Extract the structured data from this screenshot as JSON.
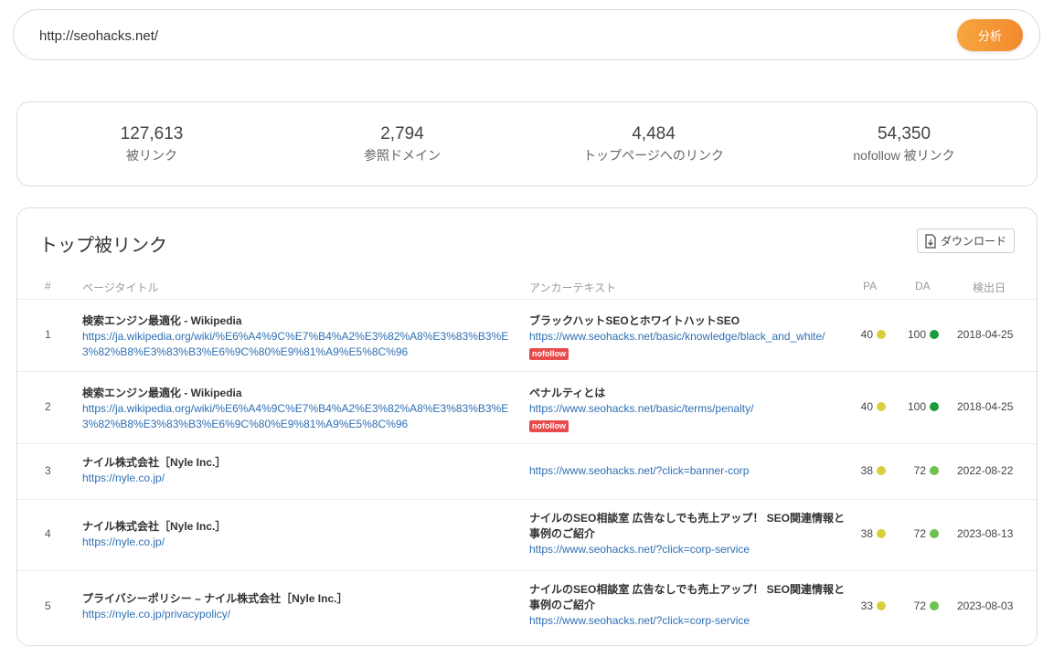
{
  "search": {
    "value": "http://seohacks.net/",
    "button_label": "分析"
  },
  "stats": [
    {
      "value": "127,613",
      "label": "被リンク"
    },
    {
      "value": "2,794",
      "label": "参照ドメイン"
    },
    {
      "value": "4,484",
      "label": "トップページへのリンク"
    },
    {
      "value": "54,350",
      "label": "nofollow 被リンク"
    }
  ],
  "panel": {
    "title": "トップ被リンク",
    "download_label": "ダウンロード",
    "columns": {
      "num": "#",
      "page_title": "ページタイトル",
      "anchor": "アンカーテキスト",
      "pa": "PA",
      "da": "DA",
      "date": "検出日"
    }
  },
  "colors": {
    "accent": "#f28a2e",
    "link": "#2f6fb4",
    "badge": "#e84b4b",
    "dot_yellow": "#d9cf3a",
    "dot_green_dark": "#1a9c3a",
    "dot_green": "#6cc24a"
  },
  "rows": [
    {
      "num": "1",
      "title": "検索エンジン最適化 - Wikipedia",
      "url": "https://ja.wikipedia.org/wiki/%E6%A4%9C%E7%B4%A2%E3%82%A8%E3%83%B3%E3%82%B8%E3%83%B3%E6%9C%80%E9%81%A9%E5%8C%96",
      "anchor": "ブラックハットSEOとホワイトハットSEO",
      "anchor_url": "https://www.seohacks.net/basic/knowledge/black_and_white/",
      "nofollow": "nofollow",
      "pa": "40",
      "da": "100",
      "date": "2018-04-25"
    },
    {
      "num": "2",
      "title": "検索エンジン最適化 - Wikipedia",
      "url": "https://ja.wikipedia.org/wiki/%E6%A4%9C%E7%B4%A2%E3%82%A8%E3%83%B3%E3%82%B8%E3%83%B3%E6%9C%80%E9%81%A9%E5%8C%96",
      "anchor": "ペナルティとは",
      "anchor_url": "https://www.seohacks.net/basic/terms/penalty/",
      "nofollow": "nofollow",
      "pa": "40",
      "da": "100",
      "date": "2018-04-25"
    },
    {
      "num": "3",
      "title": "ナイル株式会社［Nyle Inc.］",
      "url": "https://nyle.co.jp/",
      "anchor": "",
      "anchor_url": "https://www.seohacks.net/?click=banner-corp",
      "nofollow": "",
      "pa": "38",
      "da": "72",
      "date": "2022-08-22"
    },
    {
      "num": "4",
      "title": "ナイル株式会社［Nyle Inc.］",
      "url": "https://nyle.co.jp/",
      "anchor": "ナイルのSEO相談室 広告なしでも売上アップ！ SEO関連情報と事例のご紹介",
      "anchor_url": "https://www.seohacks.net/?click=corp-service",
      "nofollow": "",
      "pa": "38",
      "da": "72",
      "date": "2023-08-13"
    },
    {
      "num": "5",
      "title": "プライバシーポリシー – ナイル株式会社［Nyle Inc.］",
      "url": "https://nyle.co.jp/privacypolicy/",
      "anchor": "ナイルのSEO相談室 広告なしでも売上アップ！ SEO関連情報と事例のご紹介",
      "anchor_url": "https://www.seohacks.net/?click=corp-service",
      "nofollow": "",
      "pa": "33",
      "da": "72",
      "date": "2023-08-03"
    }
  ]
}
